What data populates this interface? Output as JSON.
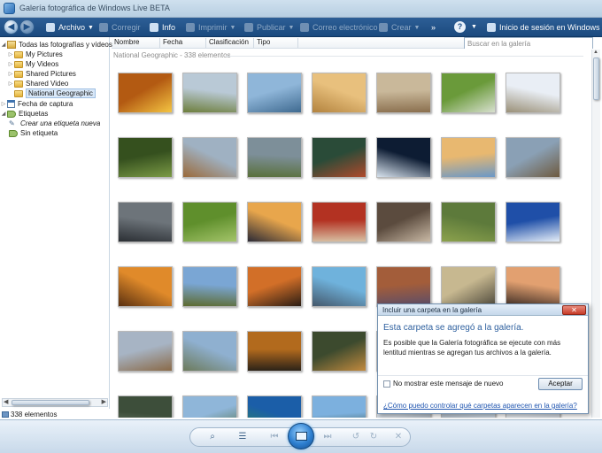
{
  "window": {
    "title": "Galería fotográfica de Windows Live BETA"
  },
  "toolbar": {
    "archivo": "Archivo",
    "corregir": "Corregir",
    "info": "Info",
    "imprimir": "Imprimir",
    "publicar": "Publicar",
    "correo": "Correo electrónico",
    "crear": "Crear",
    "more": "»",
    "help": "?",
    "signin": "Inicio de sesión en Windows Live"
  },
  "tree": {
    "items": [
      {
        "label": "Todas las fotografías y vídeos",
        "icon": "library-icon"
      },
      {
        "label": "My Pictures",
        "icon": "folder-icon"
      },
      {
        "label": "My Videos",
        "icon": "folder-icon"
      },
      {
        "label": "Shared Pictures",
        "icon": "folder-icon"
      },
      {
        "label": "Shared Video",
        "icon": "folder-icon"
      },
      {
        "label": "National Geographic",
        "icon": "folder-icon"
      },
      {
        "label": "Fecha de captura",
        "icon": "calendar-icon"
      },
      {
        "label": "Etiquetas",
        "icon": "tag-icon"
      },
      {
        "label": "Crear una etiqueta nueva",
        "icon": "pen-icon"
      },
      {
        "label": "Sin etiqueta",
        "icon": "tag-icon"
      }
    ]
  },
  "columns": [
    "Nombre",
    "Fecha",
    "Clasificación",
    "Tipo"
  ],
  "search": {
    "placeholder": "Buscar en la galería"
  },
  "group": {
    "label": "National Geographic - 338 elementos"
  },
  "status": {
    "count": "338 elementos"
  },
  "bottombar": {
    "zoom": "⌕",
    "details": "☰",
    "prev": "⏮",
    "next": "⏭",
    "rotate_left": "↺",
    "rotate_right": "↻",
    "delete": "✕"
  },
  "dialog": {
    "title": "Incluir una carpeta en la galería",
    "close": "✕",
    "heading": "Esta carpeta se agregó a la galería.",
    "body": "Es posible que la Galería fotográfica se ejecute con más lentitud mientras se agregan tus archivos a la galería.",
    "checkbox": "No mostrar este mensaje de nuevo",
    "ok": "Aceptar",
    "link": "¿Cómo puedo controlar qué carpetas aparecen en la galería?"
  },
  "thumbnails": [
    [
      "#b35a12",
      "#f4c542"
    ],
    [
      "#b9c9d6",
      "#6d7e3c"
    ],
    [
      "#8fb6d9",
      "#3f6a90"
    ],
    [
      "#e8c07d",
      "#b3833e"
    ],
    [
      "#c9b89a",
      "#8a6f4e"
    ],
    [
      "#6a9a3a",
      "#d8e0cf"
    ],
    [
      "#e9eef5",
      "#9a9078"
    ],
    [
      "#35501e",
      "#7b9a45"
    ],
    [
      "#9fb1c2",
      "#9a6a3a"
    ],
    [
      "#7d8f99",
      "#59703a"
    ],
    [
      "#2a4b38",
      "#b04a2c"
    ],
    [
      "#0d1c33",
      "#d8e3ee"
    ],
    [
      "#e8b870",
      "#6a98c8"
    ],
    [
      "#8aa0b5",
      "#6e5a3f"
    ],
    [
      "#6d747a",
      "#2b2f34"
    ],
    [
      "#5f8f2c",
      "#a4c46a"
    ],
    [
      "#e8a64c",
      "#2b2a36"
    ],
    [
      "#b33222",
      "#d8c1a4"
    ],
    [
      "#5b4b3e",
      "#c9b9a5"
    ],
    [
      "#5d7a3b",
      "#8ca24d"
    ],
    [
      "#1f4fa8",
      "#e6eef8"
    ],
    [
      "#e08a2a",
      "#5a3010"
    ],
    [
      "#7aa6d4",
      "#5d6a2e"
    ],
    [
      "#d26f28",
      "#2a1d14"
    ],
    [
      "#6fb2dc",
      "#45586b"
    ],
    [
      "#a35d3a",
      "#5a4d6a"
    ],
    [
      "#c7b890",
      "#4f4a3c"
    ],
    [
      "#e2a070",
      "#3c2c24"
    ],
    [
      "#a7b4c4",
      "#8a6a48"
    ],
    [
      "#8fb0d0",
      "#6c7a5a"
    ],
    [
      "#b26a1d",
      "#2c2218"
    ],
    [
      "#3c4a2e",
      "#c28a3e"
    ],
    [
      "#d8c3a6",
      "#8b7e68"
    ],
    [
      "#c5d6e6",
      "#a0b0c0"
    ],
    [
      "#9ac2e0",
      "#b5a48c"
    ],
    [
      "#3d4e3a",
      "#7f8c7a"
    ],
    [
      "#8fb6d9",
      "#4d6b3e"
    ],
    [
      "#1b5ea8",
      "#2f8a5a"
    ],
    [
      "#7cb0de",
      "#2a3e25"
    ],
    [
      "#d0d8e0",
      "#9aa8b6"
    ],
    [
      "#c9d4df",
      "#8e9aa6"
    ],
    [
      "#e1e6ec",
      "#b0bac4"
    ]
  ]
}
